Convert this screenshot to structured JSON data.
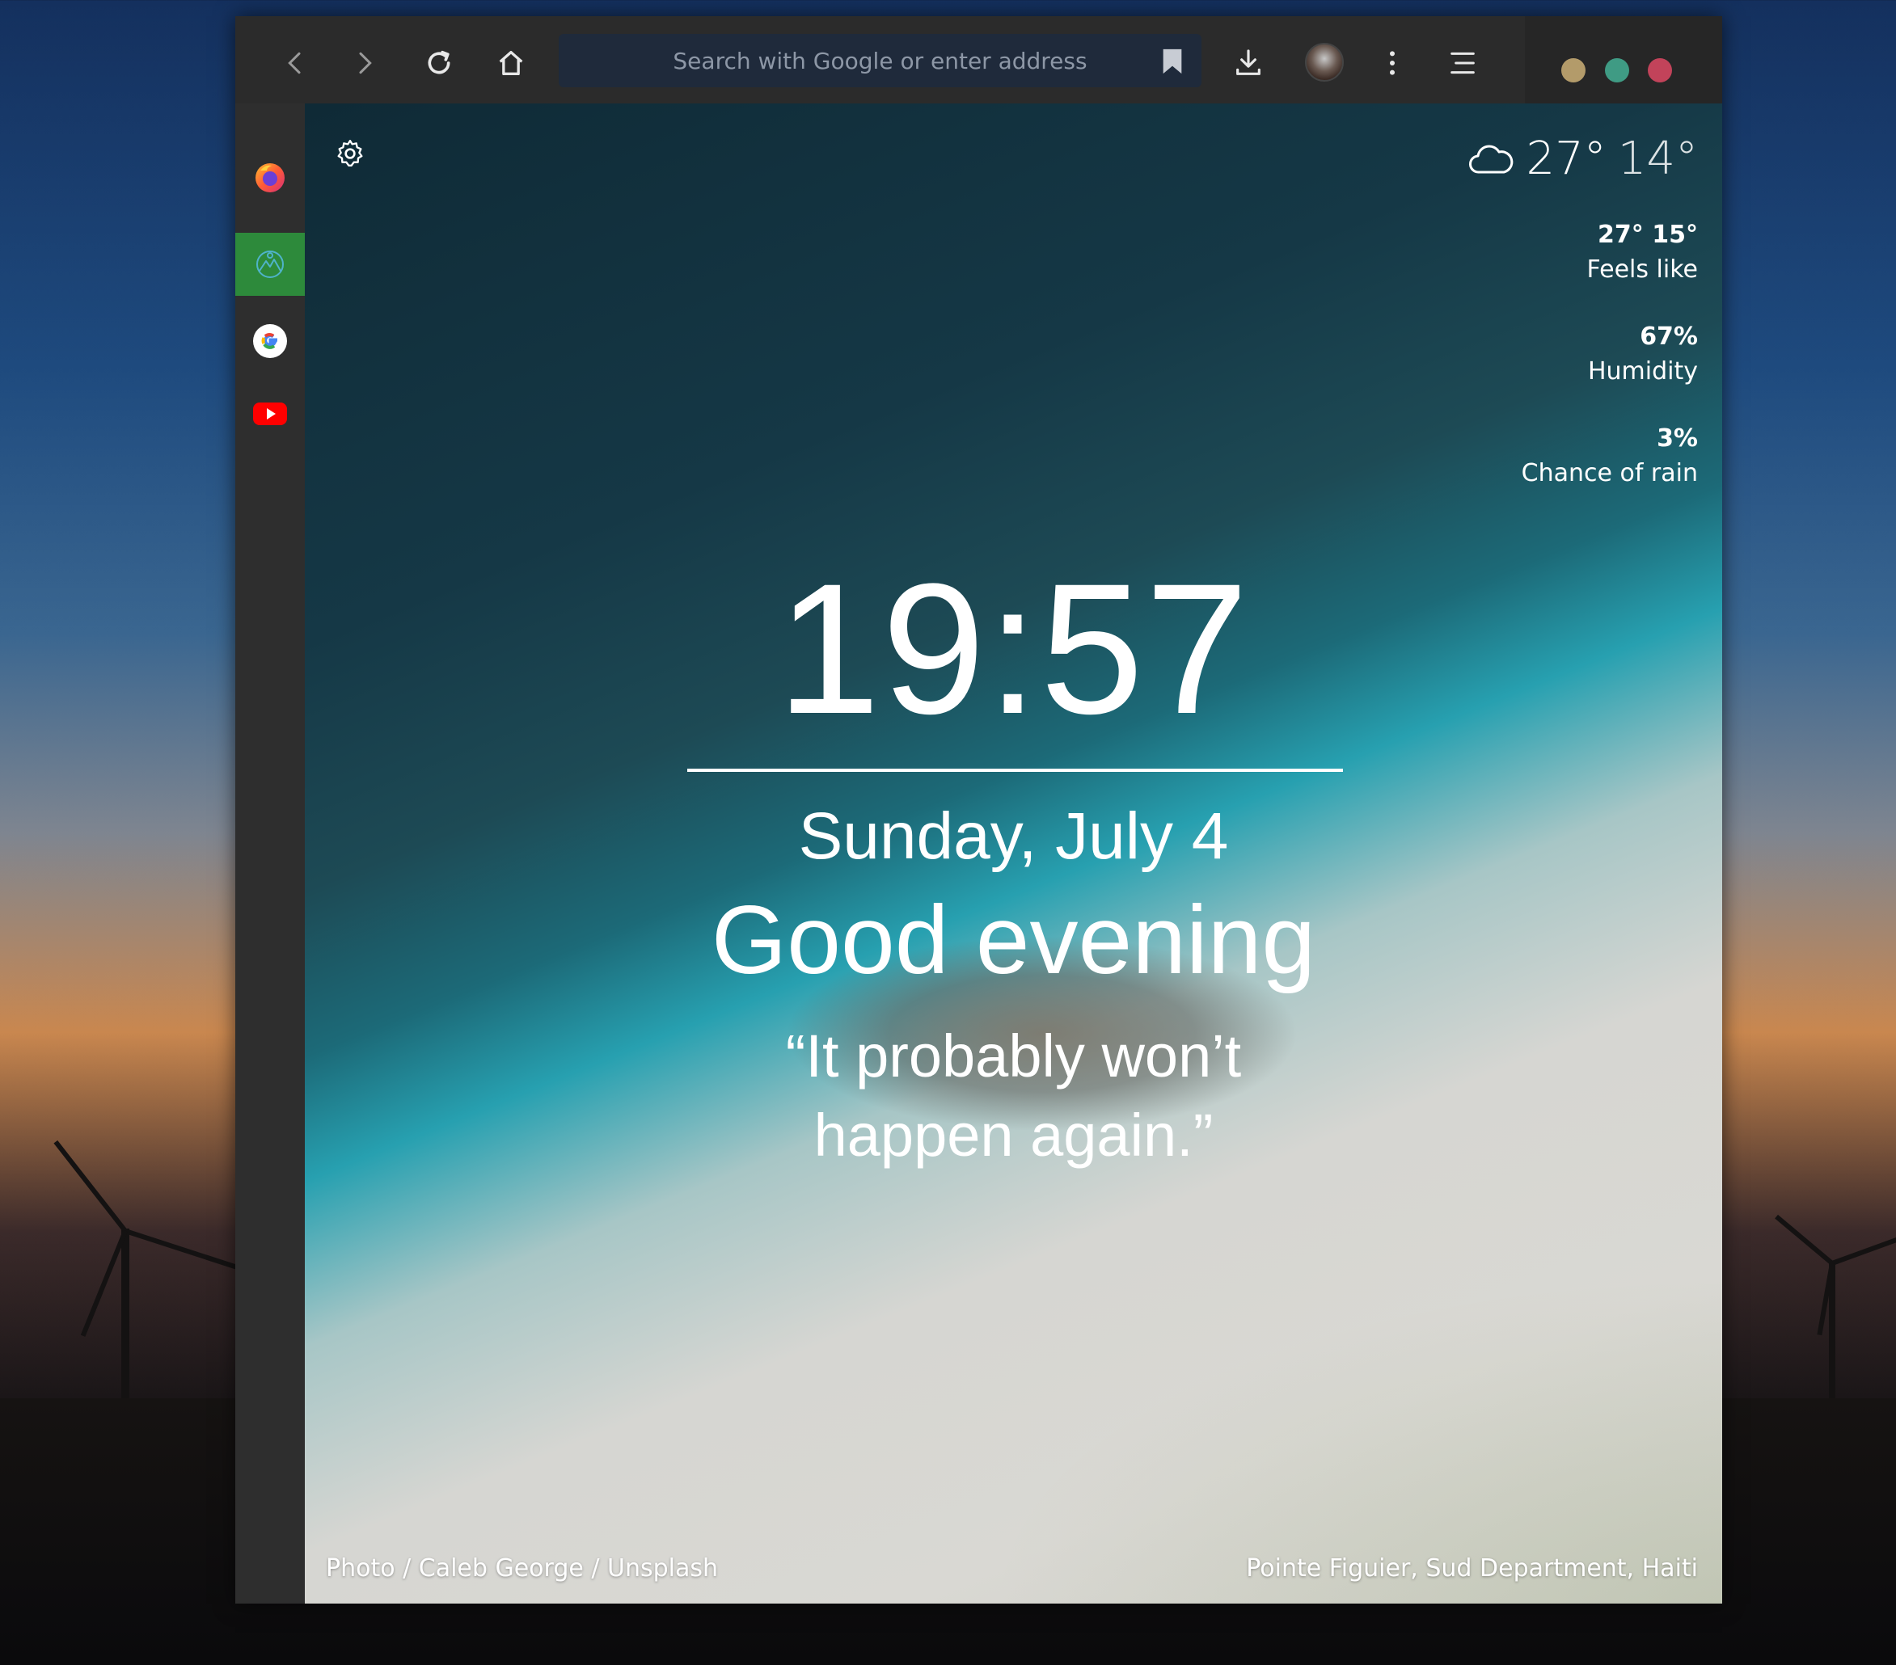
{
  "toolbar": {
    "search_placeholder": "Search with Google or enter address",
    "traffic_colors": [
      "#b39b6a",
      "#3f9b84",
      "#c2435a"
    ]
  },
  "sidebar": {
    "items": [
      {
        "icon": "firefox-icon"
      },
      {
        "icon": "mountains-icon",
        "active": true
      },
      {
        "icon": "google-icon"
      },
      {
        "icon": "youtube-icon"
      }
    ]
  },
  "weather": {
    "high": "27°",
    "low": "14°",
    "stats": [
      {
        "value": "27° 15°",
        "label": "Feels like"
      },
      {
        "value": "67%",
        "label": "Humidity"
      },
      {
        "value": "3%",
        "label": "Chance of rain"
      }
    ]
  },
  "main": {
    "time": "19:57",
    "date": "Sunday, July 4",
    "greeting": "Good evening",
    "quote_line1": "“It probably won’t",
    "quote_line2": "happen again.”"
  },
  "footer": {
    "photo_credit": "Photo / Caleb George / Unsplash",
    "location": "Pointe Figuier, Sud Department, Haiti"
  }
}
